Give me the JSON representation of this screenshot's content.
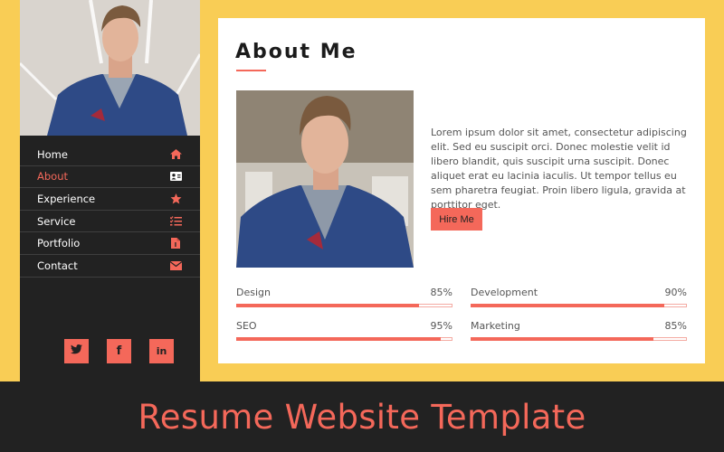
{
  "sidebar": {
    "profile_photo_alt": "Man in blue blazer",
    "nav": [
      {
        "label": "Home",
        "icon": "home-icon",
        "active": false
      },
      {
        "label": "About",
        "icon": "id-card-icon",
        "active": true
      },
      {
        "label": "Experience",
        "icon": "star-icon",
        "active": false
      },
      {
        "label": "Service",
        "icon": "checklist-icon",
        "active": false
      },
      {
        "label": "Portfolio",
        "icon": "file-icon",
        "active": false
      },
      {
        "label": "Contact",
        "icon": "envelope-icon",
        "active": false
      }
    ],
    "socials": [
      {
        "name": "twitter-icon",
        "glyph": "🐦"
      },
      {
        "name": "facebook-icon",
        "glyph": "f"
      },
      {
        "name": "linkedin-icon",
        "glyph": "in"
      }
    ]
  },
  "about": {
    "title": "About Me",
    "paragraph": "Lorem ipsum dolor sit amet, consectetur adipiscing elit. Sed eu suscipit orci. Donec molestie velit id libero blandit, quis suscipit urna suscipit. Donec aliquet erat eu lacinia iaculis. Ut tempor tellus eu sem pharetra feugiat. Proin libero ligula, gravida at porttitor eget.",
    "hire_label": "Hire Me",
    "skills": [
      {
        "name": "Design",
        "percent_label": "85%",
        "value": 85
      },
      {
        "name": "Development",
        "percent_label": "90%",
        "value": 90
      },
      {
        "name": "SEO",
        "percent_label": "95%",
        "value": 95
      },
      {
        "name": "Marketing",
        "percent_label": "85%",
        "value": 85
      }
    ]
  },
  "banner": {
    "title": "Resume Website Template"
  },
  "colors": {
    "accent": "#f4685a",
    "background": "#f9cd55",
    "dark": "#222222"
  }
}
